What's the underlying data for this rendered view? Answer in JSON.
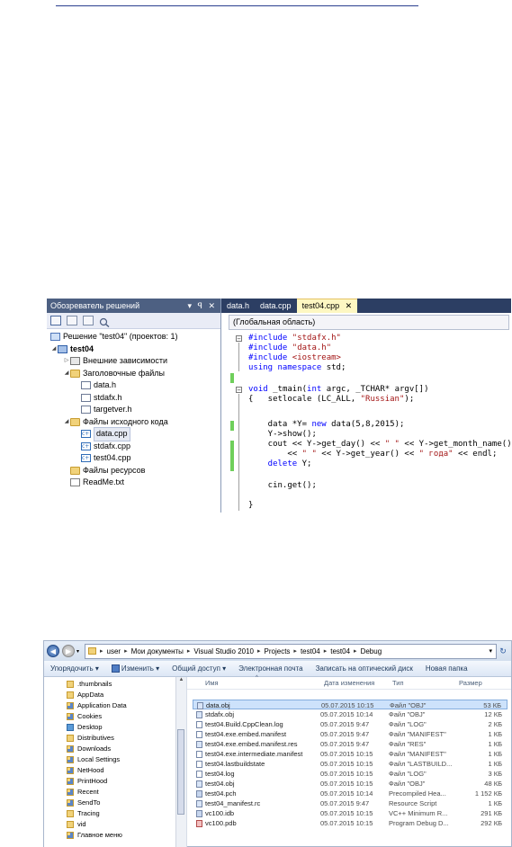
{
  "solution_explorer": {
    "title": "Обозреватель решений",
    "title_controls": "▾ ꟼ ✕",
    "items": [
      {
        "label": "Решение \"test04\"  (проектов: 1)",
        "level": 0,
        "icon": "solution-icon"
      },
      {
        "label": "test04",
        "level": 1,
        "icon": "project-icon"
      },
      {
        "label": "Внешние зависимости",
        "level": 2,
        "icon": "folder-icon"
      },
      {
        "label": "Заголовочные файлы",
        "level": 2,
        "icon": "folder-icon"
      },
      {
        "label": "data.h",
        "level": 3,
        "icon": "header-file-icon"
      },
      {
        "label": "stdafx.h",
        "level": 3,
        "icon": "header-file-icon"
      },
      {
        "label": "targetver.h",
        "level": 3,
        "icon": "header-file-icon"
      },
      {
        "label": "Файлы исходного кода",
        "level": 2,
        "icon": "folder-icon"
      },
      {
        "label": "data.cpp",
        "level": 3,
        "icon": "cpp-file-icon"
      },
      {
        "label": "stdafx.cpp",
        "level": 3,
        "icon": "cpp-file-icon"
      },
      {
        "label": "test04.cpp",
        "level": 3,
        "icon": "cpp-file-icon"
      },
      {
        "label": "Файлы ресурсов",
        "level": 2,
        "icon": "folder-icon"
      },
      {
        "label": "ReadMe.txt",
        "level": 2,
        "icon": "text-file-icon"
      }
    ]
  },
  "editor": {
    "tabs": [
      {
        "label": "data.h"
      },
      {
        "label": "data.cpp"
      },
      {
        "label": "test04.cpp",
        "close": "✕"
      }
    ],
    "scope": "(Глобальная область)",
    "code": {
      "l1": {
        "kw": "#include",
        "str": "\"stdafx.h\""
      },
      "l2": {
        "kw": "#include",
        "str": "\"data.h\""
      },
      "l3": {
        "kw": "#include",
        "str": "<iostream>"
      },
      "l4": {
        "kw1": "using",
        "kw2": "namespace",
        "text": " std;"
      },
      "l5": {
        "kw": "void",
        "text": " _tmain(",
        "kw2": "int",
        "text2": " argc, _TCHAR* argv[])"
      },
      "l6": {
        "text1": "{   setlocale (LC_ALL, ",
        "str": "\"Russian\"",
        "text2": ");"
      },
      "l7": {
        "text1": "    data *Y= ",
        "kw": "new",
        "text2": " data(5,8,2015);"
      },
      "l8": {
        "text": "    Y->show();"
      },
      "l9": {
        "text1": "    cout << Y->get_day() << ",
        "str1": "\" \"",
        "text2": " << Y->get_month_name()"
      },
      "l10": {
        "text1": "        << ",
        "str1": "\" \"",
        "text2": " << Y->get_year() << ",
        "str2": "\" года\"",
        "text3": " << endl;"
      },
      "l11": {
        "kw": "    delete",
        "text": " Y;"
      },
      "l12": {
        "text": "    cin.get();"
      },
      "l13": {
        "text": "}"
      }
    }
  },
  "explorer": {
    "breadcrumbs": [
      "user",
      "Мои документы",
      "Visual Studio 2010",
      "Projects",
      "test04",
      "test04",
      "Debug"
    ],
    "toolbar": [
      "Упорядочить ▾",
      "Изменить ▾",
      "Общий доступ ▾",
      "Электронная почта",
      "Записать на оптический диск",
      "Новая папка"
    ],
    "nav_items": [
      {
        "label": ".thumbnails",
        "icon": "folder-icon"
      },
      {
        "label": "AppData",
        "icon": "folder-icon"
      },
      {
        "label": "Application Data",
        "icon": "shortcut-folder-icon"
      },
      {
        "label": "Cookies",
        "icon": "shortcut-folder-icon"
      },
      {
        "label": "Desktop",
        "icon": "desktop-folder-icon"
      },
      {
        "label": "Distributives",
        "icon": "folder-icon"
      },
      {
        "label": "Downloads",
        "icon": "downloads-folder-icon"
      },
      {
        "label": "Local Settings",
        "icon": "shortcut-folder-icon"
      },
      {
        "label": "NetHood",
        "icon": "shortcut-folder-icon"
      },
      {
        "label": "PrintHood",
        "icon": "shortcut-folder-icon"
      },
      {
        "label": "Recent",
        "icon": "shortcut-folder-icon"
      },
      {
        "label": "SendTo",
        "icon": "shortcut-folder-icon"
      },
      {
        "label": "Tracing",
        "icon": "folder-icon"
      },
      {
        "label": "vid",
        "icon": "folder-icon"
      },
      {
        "label": "Главное меню",
        "icon": "shortcut-folder-icon"
      }
    ],
    "columns": {
      "name": "Имя",
      "date": "Дата изменения",
      "type": "Тип",
      "size": "Размер"
    },
    "files": [
      {
        "name": "data.obj",
        "date": "05.07.2015 10:15",
        "type": "Файл \"OBJ\"",
        "size": "53 КБ",
        "icon": "obj"
      },
      {
        "name": "stdafx.obj",
        "date": "05.07.2015 10:14",
        "type": "Файл \"OBJ\"",
        "size": "12 КБ",
        "icon": "obj"
      },
      {
        "name": "test04.Build.CppClean.log",
        "date": "05.07.2015 9:47",
        "type": "Файл \"LOG\"",
        "size": "2 КБ",
        "icon": "log"
      },
      {
        "name": "test04.exe.embed.manifest",
        "date": "05.07.2015 9:47",
        "type": "Файл \"MANIFEST\"",
        "size": "1 КБ",
        "icon": "plain"
      },
      {
        "name": "test04.exe.embed.manifest.res",
        "date": "05.07.2015 9:47",
        "type": "Файл \"RES\"",
        "size": "1 КБ",
        "icon": "res"
      },
      {
        "name": "test04.exe.intermediate.manifest",
        "date": "05.07.2015 10:15",
        "type": "Файл \"MANIFEST\"",
        "size": "1 КБ",
        "icon": "plain"
      },
      {
        "name": "test04.lastbuildstate",
        "date": "05.07.2015 10:15",
        "type": "Файл \"LASTBUILD...",
        "size": "1 КБ",
        "icon": "plain"
      },
      {
        "name": "test04.log",
        "date": "05.07.2015 10:15",
        "type": "Файл \"LOG\"",
        "size": "3 КБ",
        "icon": "log"
      },
      {
        "name": "test04.obj",
        "date": "05.07.2015 10:15",
        "type": "Файл \"OBJ\"",
        "size": "48 КБ",
        "icon": "obj"
      },
      {
        "name": "test04.pch",
        "date": "05.07.2015 10:14",
        "type": "Precompiled Hea...",
        "size": "1 152 КБ",
        "icon": "pch"
      },
      {
        "name": "test04_manifest.rc",
        "date": "05.07.2015 9:47",
        "type": "Resource Script",
        "size": "1 КБ",
        "icon": "rc"
      },
      {
        "name": "vc100.idb",
        "date": "05.07.2015 10:15",
        "type": "VC++ Minimum R...",
        "size": "291 КБ",
        "icon": "idb"
      },
      {
        "name": "vc100.pdb",
        "date": "05.07.2015 10:15",
        "type": "Program Debug D...",
        "size": "292 КБ",
        "icon": "pdb"
      }
    ]
  }
}
